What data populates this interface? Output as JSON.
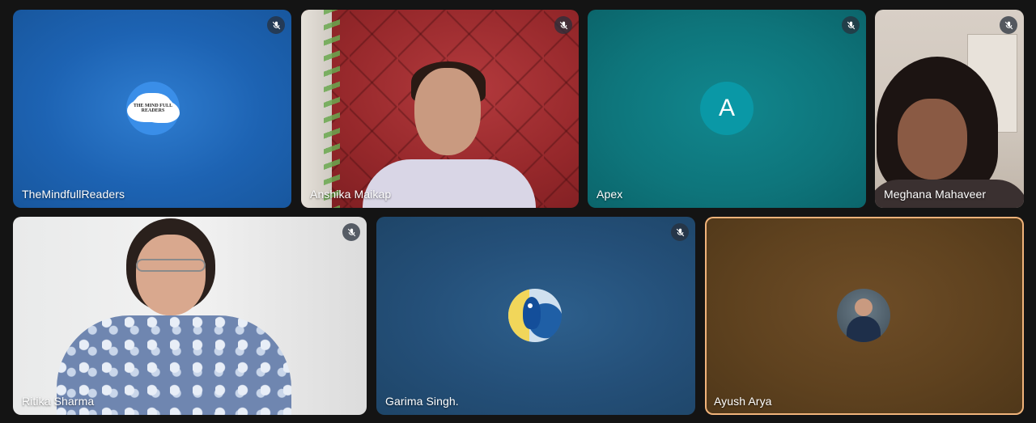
{
  "participants": [
    {
      "name": "TheMindfullReaders",
      "avatar_text": "THE MIND FULL READERS",
      "muted": true,
      "video": false
    },
    {
      "name": "Anshika Maikap",
      "muted": true,
      "video": true
    },
    {
      "name": "Apex",
      "avatar_letter": "A",
      "muted": true,
      "video": false
    },
    {
      "name": "Meghana Mahaveer",
      "muted": true,
      "video": true
    },
    {
      "name": "Ritika Sharma",
      "muted": true,
      "video": true
    },
    {
      "name": "Garima Singh.",
      "muted": true,
      "video": false
    },
    {
      "name": "Ayush Arya",
      "muted": false,
      "video": false,
      "active_speaker": true
    }
  ],
  "colors": {
    "background": "#141414",
    "active_border": "#f0b37a"
  }
}
